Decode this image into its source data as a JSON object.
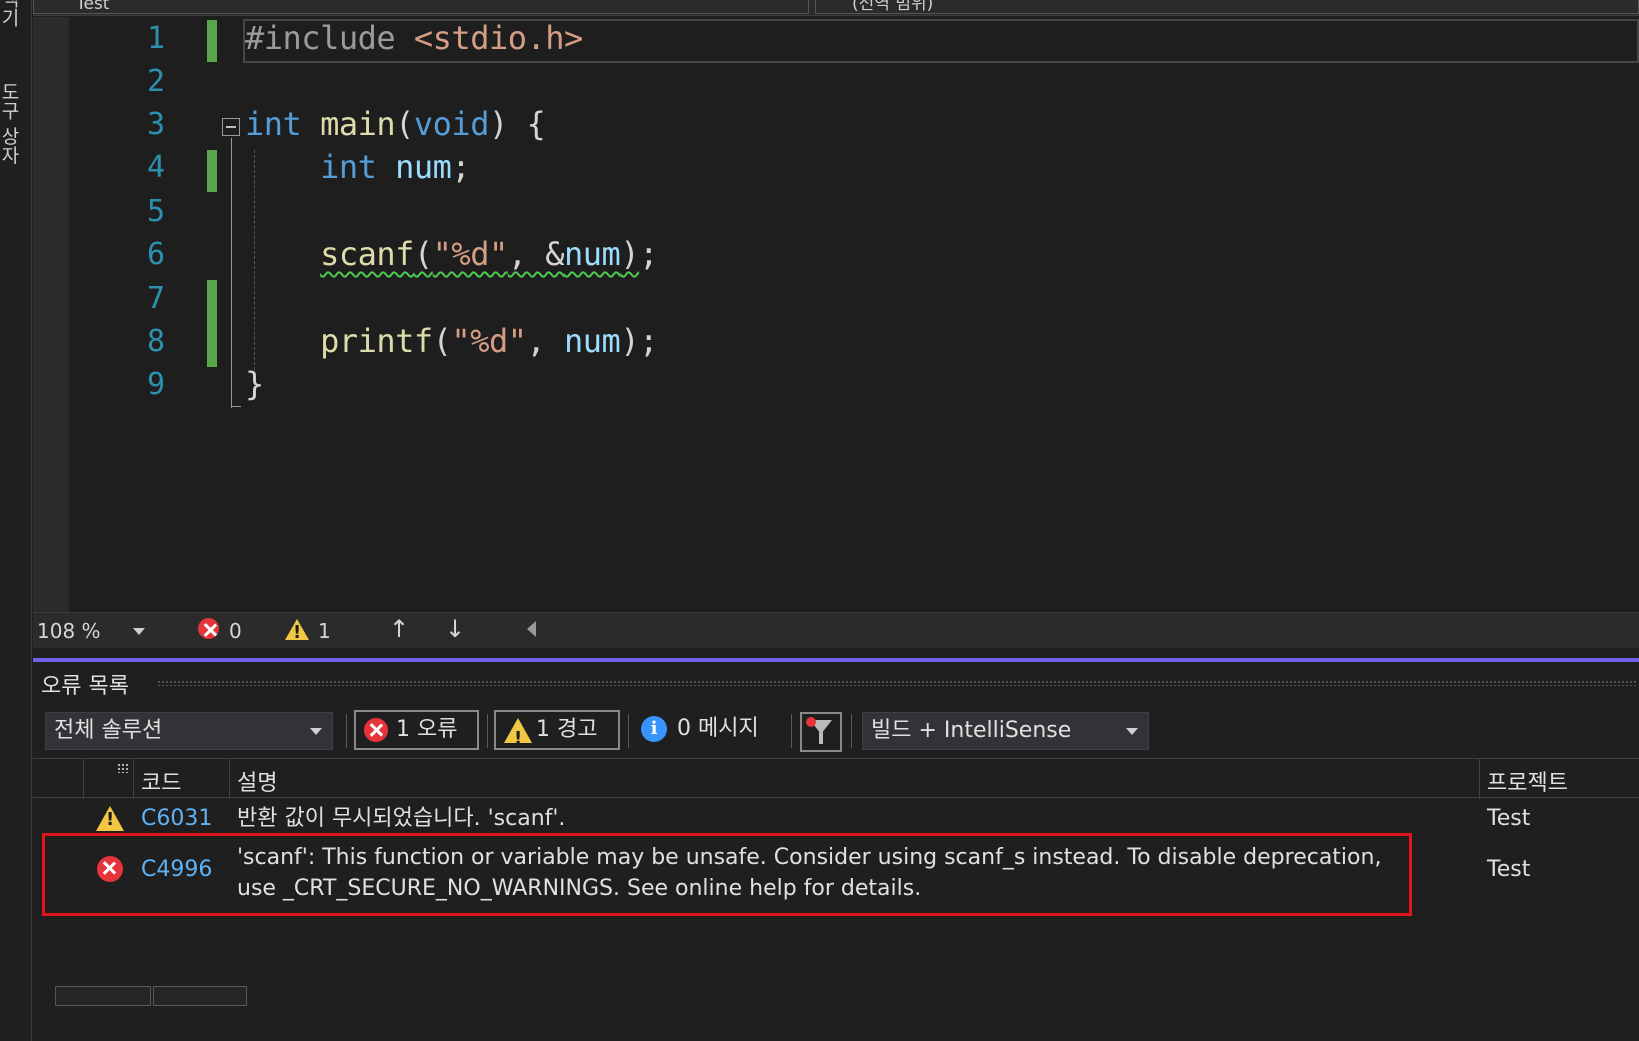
{
  "side_strip": {
    "tabs": [
      "탐색기",
      "도구 상자"
    ]
  },
  "nav_bar": {
    "project_combo": "Test",
    "scope_combo": "(전역 범위)"
  },
  "editor": {
    "line_numbers": [
      "1",
      "2",
      "3",
      "4",
      "5",
      "6",
      "7",
      "8",
      "9"
    ],
    "code": {
      "l1_directive": "#include",
      "l1_header": "<stdio.h>",
      "l3_type": "int",
      "l3_fn": "main",
      "l3_paren_open": "(",
      "l3_void": "void",
      "l3_rest": ") {",
      "l4_type": "int",
      "l4_var": "num",
      "l4_semi": ";",
      "l6_fn": "scanf",
      "l6_open": "(",
      "l6_str": "\"%d\"",
      "l6_comma": ", &",
      "l6_var": "num",
      "l6_close": ")",
      "l6_semi": ";",
      "l8_fn": "printf",
      "l8_open": "(",
      "l8_str": "\"%d\"",
      "l8_comma": ", ",
      "l8_var": "num",
      "l8_close": ");",
      "l9_brace": "}"
    }
  },
  "editor_status": {
    "zoom": "108 %",
    "errors": "0",
    "warnings": "1"
  },
  "error_list": {
    "title": "오류 목록",
    "scope_combo": "전체 솔루션",
    "errors_filter": "1 오류",
    "warnings_filter": "1 경고",
    "messages_filter": "0 메시지",
    "source_combo": "빌드 + IntelliSense",
    "columns": {
      "code": "코드",
      "description": "설명",
      "project": "프로젝트"
    },
    "rows": [
      {
        "severity": "warning",
        "code": "C6031",
        "description": "반환 값이 무시되었습니다. 'scanf'.",
        "project": "Test"
      },
      {
        "severity": "error",
        "code": "C4996",
        "description": "'scanf': This function or variable may be unsafe. Consider using scanf_s instead. To disable deprecation, use _CRT_SECURE_NO_WARNINGS. See online help for details.",
        "project": "Test"
      }
    ]
  },
  "colors": {
    "keyword": "#569cd6",
    "string": "#d69d85",
    "function": "#dcdcaa",
    "variable": "#9cdcfe",
    "line_number": "#2b91af",
    "change_bar": "#57a64a",
    "panel_accent": "#7160e8",
    "highlight_box": "#e0161b",
    "error": "#e5343a",
    "warning": "#f2c744",
    "info": "#3794ff"
  }
}
